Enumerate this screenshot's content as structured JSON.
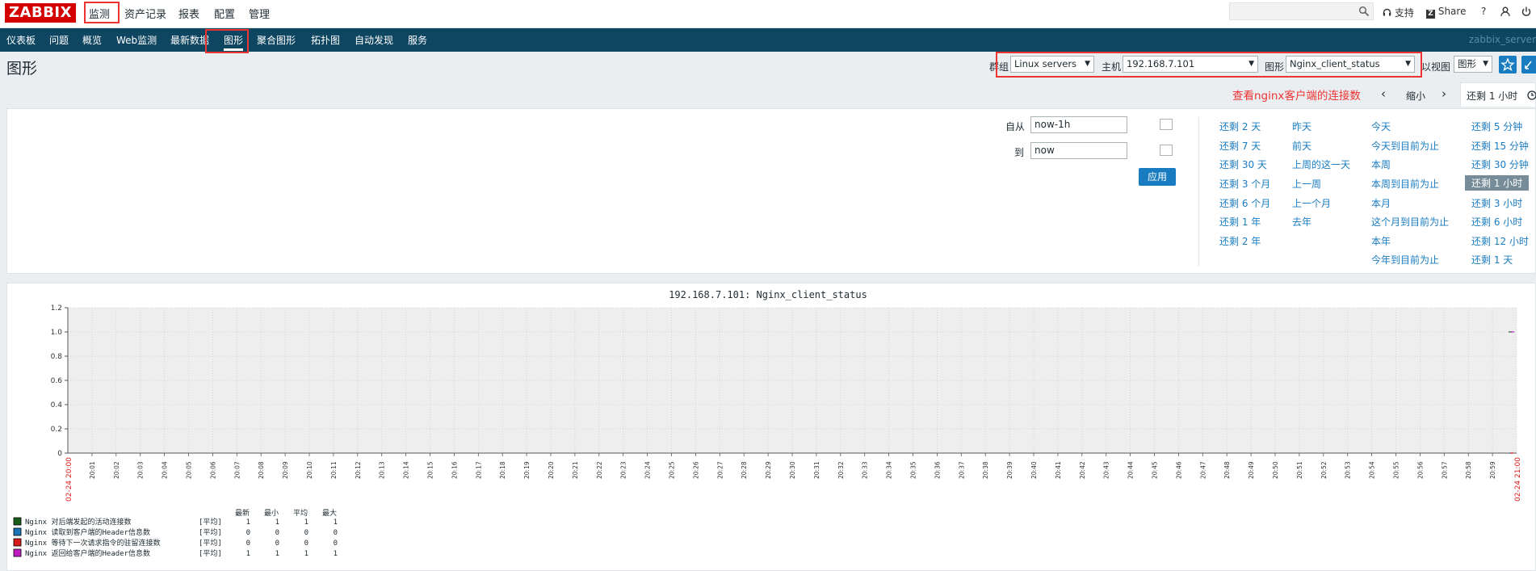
{
  "header": {
    "logo": "ZABBIX",
    "menu": [
      "监测",
      "资产记录",
      "报表",
      "配置",
      "管理"
    ],
    "support": "支持",
    "share": "Share",
    "help": "?"
  },
  "nav": {
    "items": [
      "仪表板",
      "问题",
      "概览",
      "Web监测",
      "最新数据",
      "图形",
      "聚合图形",
      "拓扑图",
      "自动发现",
      "服务"
    ],
    "hostname": "zabbix_server"
  },
  "page": {
    "title": "图形",
    "group_label": "群组",
    "group_value": "Linux servers",
    "host_label": "主机",
    "host_value": "192.168.7.101",
    "graph_label": "图形",
    "graph_value": "Nginx_client_status",
    "view_label": "以视图",
    "view_value": "图形",
    "annotation": "查看nginx客户端的连接数"
  },
  "timenav": {
    "zoom_out": "缩小",
    "active_range": "还剩 1 小时"
  },
  "filter": {
    "from_label": "自从",
    "from_value": "now-1h",
    "to_label": "到",
    "to_value": "now",
    "apply": "应用",
    "quick": [
      [
        "还剩 2 天",
        "还剩 7 天",
        "还剩 30 天",
        "还剩 3 个月",
        "还剩 6 个月",
        "还剩 1 年",
        "还剩 2 年"
      ],
      [
        "昨天",
        "前天",
        "上周的这一天",
        "上一周",
        "上一个月",
        "去年"
      ],
      [
        "今天",
        "今天到目前为止",
        "本周",
        "本周到目前为止",
        "本月",
        "这个月到目前为止",
        "本年",
        "今年到目前为止"
      ],
      [
        "还剩 5 分钟",
        "还剩 15 分钟",
        "还剩 30 分钟",
        "还剩 1 小时",
        "还剩 3 小时",
        "还剩 6 小时",
        "还剩 12 小时",
        "还剩 1 天"
      ]
    ]
  },
  "chart_data": {
    "type": "line",
    "title": "192.168.7.101: Nginx_client_status",
    "ylim": [
      0,
      1.2
    ],
    "yticks": [
      "0",
      "0.2",
      "0.4",
      "0.6",
      "0.8",
      "1.0",
      "1.2"
    ],
    "x_start_label": "02-24 20:00",
    "x_end_label": "02-24 21:00",
    "xticks": [
      "20:01",
      "20:02",
      "20:03",
      "20:04",
      "20:05",
      "20:06",
      "20:07",
      "20:08",
      "20:09",
      "20:10",
      "20:11",
      "20:12",
      "20:13",
      "20:14",
      "20:15",
      "20:16",
      "20:17",
      "20:18",
      "20:19",
      "20:20",
      "20:21",
      "20:22",
      "20:23",
      "20:24",
      "20:25",
      "20:26",
      "20:27",
      "20:28",
      "20:29",
      "20:30",
      "20:31",
      "20:32",
      "20:33",
      "20:34",
      "20:35",
      "20:36",
      "20:37",
      "20:38",
      "20:39",
      "20:40",
      "20:41",
      "20:42",
      "20:43",
      "20:44",
      "20:45",
      "20:46",
      "20:47",
      "20:48",
      "20:49",
      "20:50",
      "20:51",
      "20:52",
      "20:53",
      "20:54",
      "20:55",
      "20:56",
      "20:57",
      "20:58",
      "20:59"
    ],
    "legend_headers": [
      "最新",
      "最小",
      "平均",
      "最大"
    ],
    "series": [
      {
        "name": "Nginx 对后端发起的活动连接数",
        "func": "[平均]",
        "color": "#1a5c1a",
        "last": 1,
        "min": 1,
        "avg": 1,
        "max": 1
      },
      {
        "name": "Nginx 读取到客户端的Header信息数",
        "func": "[平均]",
        "color": "#1a74b8",
        "last": 0,
        "min": 0,
        "avg": 0,
        "max": 0
      },
      {
        "name": "Nginx 等待下一次请求指令的驻留连接数",
        "func": "[平均]",
        "color": "#d91a1a",
        "last": 0,
        "min": 0,
        "avg": 0,
        "max": 0
      },
      {
        "name": "Nginx 返回给客户端的Header信息数",
        "func": "[平均]",
        "color": "#c21ac2",
        "last": 1,
        "min": 1,
        "avg": 1,
        "max": 1
      }
    ]
  }
}
